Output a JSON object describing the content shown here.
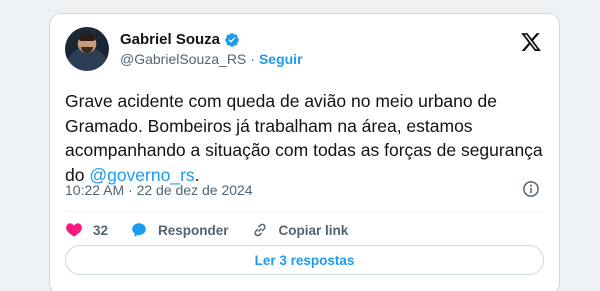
{
  "author": {
    "name": "Gabriel Souza",
    "handle": "@GabrielSouza_RS",
    "separator": "·",
    "follow_label": "Seguir"
  },
  "tweet": {
    "text_before": "Grave acidente com queda de avião no meio urbano de Gramado. Bombeiros já trabalham na área, estamos acompanhando a situação com todas as forças de segurança do ",
    "mention": "@governo_rs",
    "text_after": ".",
    "timestamp": "10:22 AM · 22 de dez de 2024"
  },
  "actions": {
    "like_count": "32",
    "reply_label": "Responder",
    "copy_link_label": "Copiar link"
  },
  "read_replies_label": "Ler 3 respostas",
  "colors": {
    "accent": "#1d9bf0",
    "like": "#f91880",
    "text": "#0f1419",
    "secondary": "#536471"
  },
  "icons": {
    "verified": "verified-badge-icon",
    "brand": "x-logo-icon",
    "info": "info-icon",
    "like": "heart-icon",
    "reply": "reply-bubble-icon",
    "copy_link": "link-icon"
  }
}
